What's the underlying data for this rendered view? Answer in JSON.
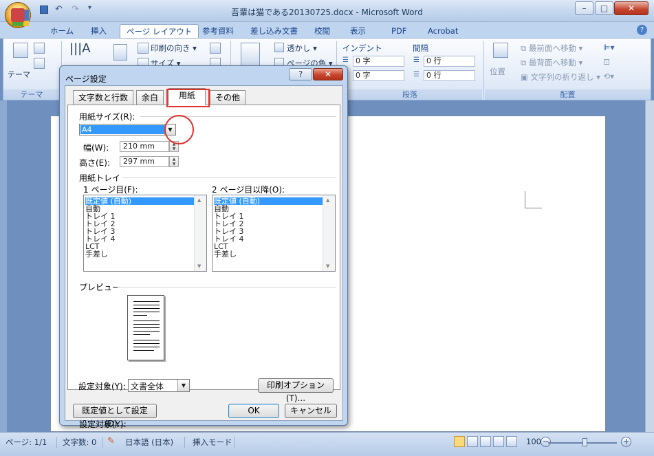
{
  "window": {
    "title": "吾輩は猫である20130725.docx - Microsoft Word",
    "controls": {
      "minimize": "–",
      "maximize": "□",
      "close": "✕"
    }
  },
  "ribbon": {
    "tabs": [
      "ホーム",
      "挿入",
      "ページ レイアウト",
      "参考資料",
      "差し込み文書",
      "校閲",
      "表示",
      "PDF",
      "Acrobat"
    ],
    "active_tab": "ページ レイアウト",
    "theme_group": {
      "label": "テーマ",
      "button": "テーマ"
    },
    "page_setup": {
      "print_orientation": "印刷の向き",
      "size": "サイズ"
    },
    "background": {
      "watermark": "透かし",
      "page_color": "ページの色"
    },
    "paragraph": {
      "label": "段落",
      "indent_header": "インデント",
      "spacing_header": "間隔",
      "indent_left": "0 字",
      "indent_right": "0 字",
      "spacing_before": "0 行",
      "spacing_after": "0 行"
    },
    "arrange": {
      "label": "配置",
      "position": "位置",
      "bring_front": "最前面へ移動",
      "send_back": "最背面へ移動",
      "text_wrap": "文字列の折り返し"
    }
  },
  "statusbar": {
    "page": "ページ: 1/1",
    "words": "文字数: 0",
    "language": "日本語 (日本)",
    "mode": "挿入モード",
    "zoom": "100%"
  },
  "dialog": {
    "title": "ページ設定",
    "help": "?",
    "close": "✕",
    "tabs": [
      "文字数と行数",
      "余白",
      "用紙",
      "その他"
    ],
    "active_tab": "用紙",
    "paper_size_label": "用紙サイズ(R):",
    "paper_size_value": "A4",
    "width_label": "幅(W):",
    "width_value": "210 mm",
    "height_label": "高さ(E):",
    "height_value": "297 mm",
    "tray_label": "用紙トレイ",
    "first_page_label": "1 ページ目(F):",
    "other_pages_label": "2 ページ目以降(O):",
    "tray_items": [
      "既定値 (自動)",
      "自動",
      "トレイ 1",
      "トレイ 2",
      "トレイ 3",
      "トレイ 4",
      "LCT",
      "手差し"
    ],
    "preview_label": "プレビュー",
    "apply_to_label": "設定対象(Y):",
    "apply_to_value": "文書全体",
    "print_options": "印刷オプション(T)...",
    "set_default": "既定値として設定(D)...",
    "ok": "OK",
    "cancel": "キャンセル"
  },
  "colors": {
    "highlight": "#3399ff",
    "annotation_red": "#e2302d",
    "ribbon_text": "#15428b"
  }
}
